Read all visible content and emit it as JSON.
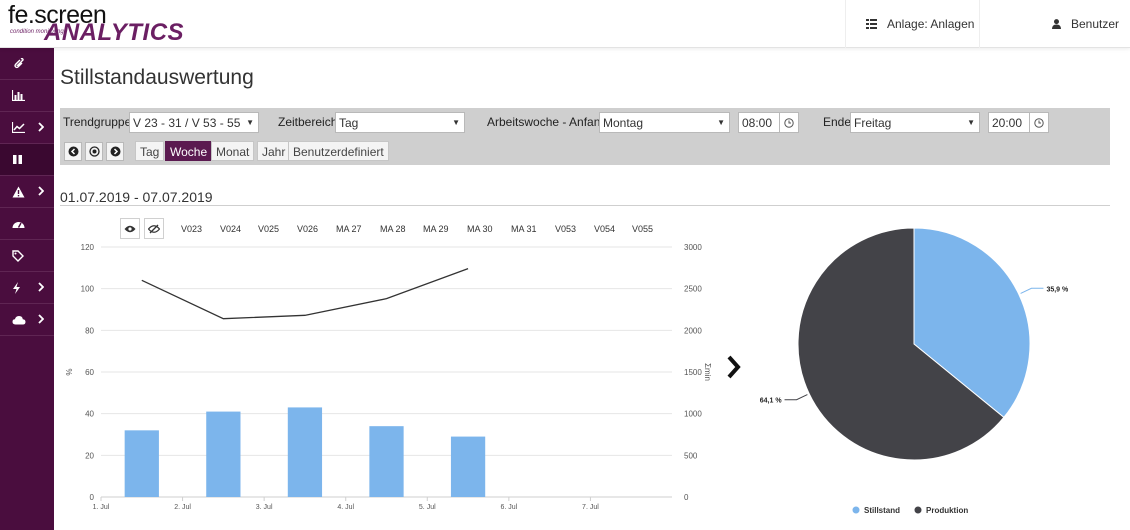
{
  "logo": {
    "line1": "fe.screen",
    "line2": "ANALYTICS",
    "line3": "condition monitoring"
  },
  "header": {
    "plant_label": "Anlage: Anlagen",
    "user_label": "Benutzer"
  },
  "sidebar": {
    "items": [
      {
        "icon": "paperclip-icon",
        "has_children": false
      },
      {
        "icon": "bar-chart-icon",
        "has_children": false
      },
      {
        "icon": "line-chart-icon",
        "has_children": true
      },
      {
        "icon": "pause-icon",
        "has_children": false,
        "active": true
      },
      {
        "icon": "warning-icon",
        "has_children": true
      },
      {
        "icon": "dashboard-icon",
        "has_children": false
      },
      {
        "icon": "tag-icon",
        "has_children": false
      },
      {
        "icon": "bolt-icon",
        "has_children": true
      },
      {
        "icon": "cloud-icon",
        "has_children": true
      }
    ]
  },
  "page": {
    "title": "Stillstandauswertung",
    "date_range": "01.07.2019 - 07.07.2019"
  },
  "filters": {
    "trendgruppe_label": "Trendgruppe",
    "trendgruppe_value": "V 23 - 31 / V 53 - 55",
    "zeitbereich_label": "Zeitbereich",
    "zeitbereich_value": "Tag",
    "arbeitswoche_label": "Arbeitswoche - Anfang",
    "arbeitswoche_value": "Montag",
    "start_time": "08:00",
    "ende_label": "Ende",
    "ende_value": "Freitag",
    "end_time": "20:00"
  },
  "periods": [
    {
      "label": "Tag",
      "active": false
    },
    {
      "label": "Woche",
      "active": true
    },
    {
      "label": "Monat",
      "active": false
    },
    {
      "label": "Jahr",
      "active": false
    },
    {
      "label": "Benutzerdefiniert",
      "active": false
    }
  ],
  "machines": [
    "V023",
    "V024",
    "V025",
    "V026",
    "MA 27",
    "MA 28",
    "MA 29",
    "MA 30",
    "MA 31",
    "V053",
    "V054",
    "V055"
  ],
  "colors": {
    "brand": "#4a0d3e",
    "accent": "#6b1f63",
    "stillstand": "#7cb5ec",
    "produktion": "#434348"
  },
  "chart_data": [
    {
      "type": "bar",
      "categories": [
        "1. Jul",
        "2. Jul",
        "3. Jul",
        "4. Jul",
        "5. Jul",
        "6. Jul",
        "7. Jul"
      ],
      "series": [
        {
          "values": [
            32,
            41,
            43,
            34,
            29,
            null,
            null
          ],
          "type": "bar",
          "axis": "left",
          "color": "#7cb5ec"
        },
        {
          "values": [
            2600,
            2140,
            2180,
            2380,
            2740,
            null,
            null
          ],
          "type": "line",
          "axis": "right",
          "color": "#333333"
        }
      ],
      "ylabel": "%",
      "ylim": [
        0,
        120
      ],
      "yticks": [
        0,
        20,
        40,
        60,
        80,
        100,
        120
      ],
      "y2label": "Σmin",
      "y2lim": [
        0,
        3000
      ],
      "y2ticks": [
        0,
        500,
        1000,
        1500,
        2000,
        2500,
        3000
      ],
      "grid": true
    },
    {
      "type": "pie",
      "slices": [
        {
          "name": "Stillstand",
          "value": 35.9,
          "label": "35,9 %",
          "color": "#7cb5ec"
        },
        {
          "name": "Produktion",
          "value": 64.1,
          "label": "64,1 %",
          "color": "#434348"
        }
      ],
      "legend": "bottom"
    }
  ]
}
